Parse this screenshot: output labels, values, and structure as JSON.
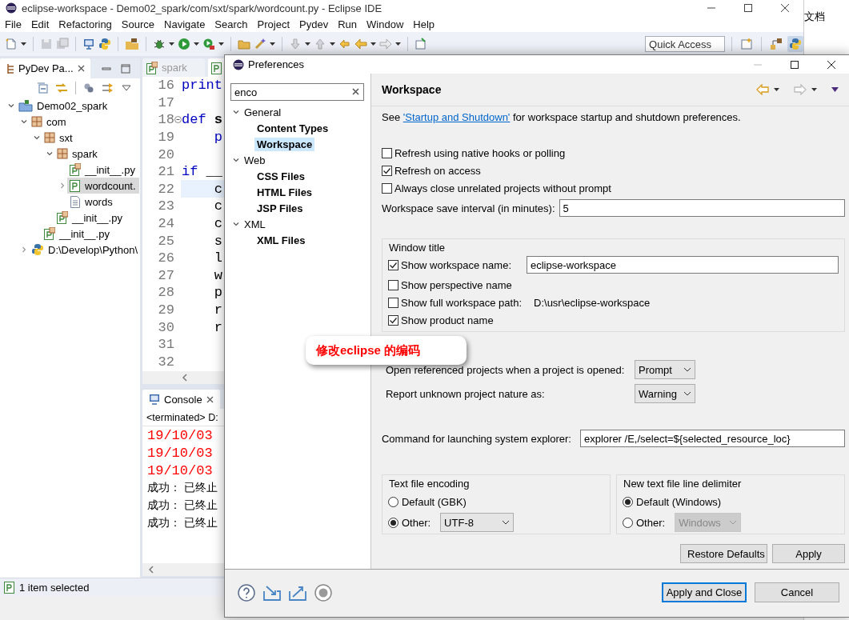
{
  "window": {
    "title": "eclipse-workspace - Demo02_spark/com/sxt/spark/wordcount.py - Eclipse IDE"
  },
  "background_window": {
    "text": "文档"
  },
  "menu": [
    "File",
    "Edit",
    "Refactoring",
    "Source",
    "Navigate",
    "Search",
    "Project",
    "Pydev",
    "Run",
    "Window",
    "Help"
  ],
  "quick_access": {
    "placeholder": "Quick Access"
  },
  "explorer": {
    "title": "PyDev Pa...",
    "tree": [
      {
        "label": "Demo02_spark",
        "kind": "project",
        "expanded": true,
        "selected": false,
        "children": [
          {
            "label": "com",
            "kind": "package",
            "expanded": true,
            "selected": false,
            "children": [
              {
                "label": "sxt",
                "kind": "package",
                "expanded": true,
                "selected": false,
                "children": [
                  {
                    "label": "spark",
                    "kind": "package",
                    "expanded": true,
                    "selected": false,
                    "children": [
                      {
                        "label": "__init__.py",
                        "kind": "module",
                        "selected": false
                      },
                      {
                        "label": "wordcount.",
                        "kind": "source",
                        "expanded": false,
                        "selected": true
                      },
                      {
                        "label": "words",
                        "kind": "text",
                        "selected": false
                      }
                    ]
                  },
                  {
                    "label": "__init__.py",
                    "kind": "module",
                    "selected": false
                  }
                ]
              },
              {
                "label": "__init__.py",
                "kind": "module",
                "selected": false
              }
            ]
          },
          {
            "label": "D:\\Develop\\Python\\",
            "kind": "interpreter",
            "expanded": false,
            "selected": false
          }
        ]
      }
    ]
  },
  "editor": {
    "tabs": [
      {
        "label": "spark",
        "selected": false
      }
    ],
    "lines": [
      {
        "number": "16",
        "fold": false,
        "current": false,
        "code": [
          {
            "text": "print",
            "kind": "keyword"
          }
        ]
      },
      {
        "number": "17",
        "fold": false,
        "current": false
      },
      {
        "number": "18",
        "fold": true,
        "current": false,
        "code": [
          {
            "text": "def ",
            "kind": "keyword"
          },
          {
            "text": "s",
            "kind": "name"
          }
        ]
      },
      {
        "number": "19",
        "fold": false,
        "current": false,
        "code": [
          {
            "text": "    p",
            "kind": "keyword"
          }
        ]
      },
      {
        "number": "20",
        "fold": false,
        "current": false
      },
      {
        "number": "21",
        "fold": false,
        "current": false,
        "code": [
          {
            "text": "if ",
            "kind": "keyword"
          },
          {
            "text": "__",
            "kind": "plain"
          }
        ]
      },
      {
        "number": "22",
        "fold": false,
        "current": true,
        "code": [
          {
            "text": "    c",
            "kind": "plain"
          }
        ]
      },
      {
        "number": "23",
        "fold": false,
        "current": false,
        "code": [
          {
            "text": "    c",
            "kind": "plain"
          }
        ]
      },
      {
        "number": "24",
        "fold": false,
        "current": false,
        "code": [
          {
            "text": "    c",
            "kind": "plain"
          }
        ]
      },
      {
        "number": "25",
        "fold": false,
        "current": false,
        "code": [
          {
            "text": "    s",
            "kind": "plain"
          }
        ]
      },
      {
        "number": "26",
        "fold": false,
        "current": false,
        "code": [
          {
            "text": "    l",
            "kind": "plain"
          }
        ]
      },
      {
        "number": "27",
        "fold": false,
        "current": false,
        "code": [
          {
            "text": "    w",
            "kind": "plain"
          }
        ]
      },
      {
        "number": "28",
        "fold": false,
        "current": false,
        "code": [
          {
            "text": "    p",
            "kind": "plain"
          }
        ]
      },
      {
        "number": "29",
        "fold": false,
        "current": false,
        "code": [
          {
            "text": "    r",
            "kind": "plain"
          }
        ]
      },
      {
        "number": "30",
        "fold": false,
        "current": false,
        "code": [
          {
            "text": "    r",
            "kind": "plain"
          }
        ]
      },
      {
        "number": "31",
        "fold": false,
        "current": false
      },
      {
        "number": "32",
        "fold": false,
        "current": false
      }
    ]
  },
  "console": {
    "title": "Console",
    "header": "<terminated> D:",
    "lines": [
      {
        "text": "19/10/03",
        "kind": "error"
      },
      {
        "text": "19/10/03",
        "kind": "error"
      },
      {
        "text": "19/10/03",
        "kind": "error"
      },
      {
        "text": "成功： 已终止",
        "kind": "output"
      },
      {
        "text": "成功： 已终止",
        "kind": "output"
      },
      {
        "text": "成功： 已终止",
        "kind": "output"
      }
    ]
  },
  "status_bar": {
    "text": "1 item selected"
  },
  "preferences": {
    "title": "Preferences",
    "filter": {
      "value": "enco"
    },
    "tree": [
      {
        "label": "General",
        "expanded": true,
        "selected": false,
        "children": [
          {
            "label": "Content Types",
            "selected": false
          },
          {
            "label": "Workspace",
            "selected": true
          }
        ]
      },
      {
        "label": "Web",
        "expanded": true,
        "selected": false,
        "children": [
          {
            "label": "CSS Files",
            "selected": false
          },
          {
            "label": "HTML Files",
            "selected": false
          },
          {
            "label": "JSP Files",
            "selected": false
          }
        ]
      },
      {
        "label": "XML",
        "expanded": true,
        "selected": false,
        "children": [
          {
            "label": "XML Files",
            "selected": false
          }
        ]
      }
    ],
    "page": {
      "title": "Workspace",
      "intro": {
        "before": "See",
        "link": "'Startup and Shutdown'",
        "after": "for workspace startup and shutdown preferences."
      },
      "options": [
        {
          "label": "Refresh using native hooks or polling",
          "checked": false
        },
        {
          "label": "Refresh on access",
          "checked": true
        },
        {
          "label": "Always close unrelated projects without prompt",
          "checked": false
        }
      ],
      "save_interval": {
        "label": "Workspace save interval (in minutes):",
        "value": "5"
      },
      "window_title": {
        "title": "Window title",
        "options": [
          {
            "label": "Show workspace name:",
            "checked": true,
            "kind": "field",
            "value": "eclipse-workspace"
          },
          {
            "label": "Show perspective name",
            "checked": false,
            "kind": "plain"
          },
          {
            "label": "Show full workspace path:",
            "checked": false,
            "kind": "path",
            "value": "D:\\usr\\eclipse-workspace"
          },
          {
            "label": "Show product name",
            "checked": true,
            "kind": "plain"
          }
        ]
      },
      "dropdowns": [
        {
          "label": "Open referenced projects when a project is opened:",
          "value": "Prompt"
        },
        {
          "label": "Report unknown project nature as:",
          "value": "Warning"
        }
      ],
      "explorer_command": {
        "label": "Command for launching system explorer:",
        "value": "explorer /E,/select=${selected_resource_loc}"
      },
      "encoding": {
        "title": "Text file encoding",
        "options": [
          {
            "label": "Default (GBK)",
            "selected": false
          },
          {
            "label": "Other:",
            "selected": true
          }
        ],
        "other_value": "UTF-8",
        "disabled": false
      },
      "delimiter": {
        "title": "New text file line delimiter",
        "options": [
          {
            "label": "Default (Windows)",
            "selected": true
          },
          {
            "label": "Other:",
            "selected": false
          }
        ],
        "other_value": "Windows",
        "disabled": true
      },
      "buttons": [
        "Restore Defaults",
        "Apply"
      ]
    },
    "footer_buttons": [
      {
        "label": "Apply and Close",
        "default": true
      },
      {
        "label": "Cancel",
        "default": false
      }
    ]
  },
  "annotation": {
    "text": "修改eclipse 的编码"
  }
}
